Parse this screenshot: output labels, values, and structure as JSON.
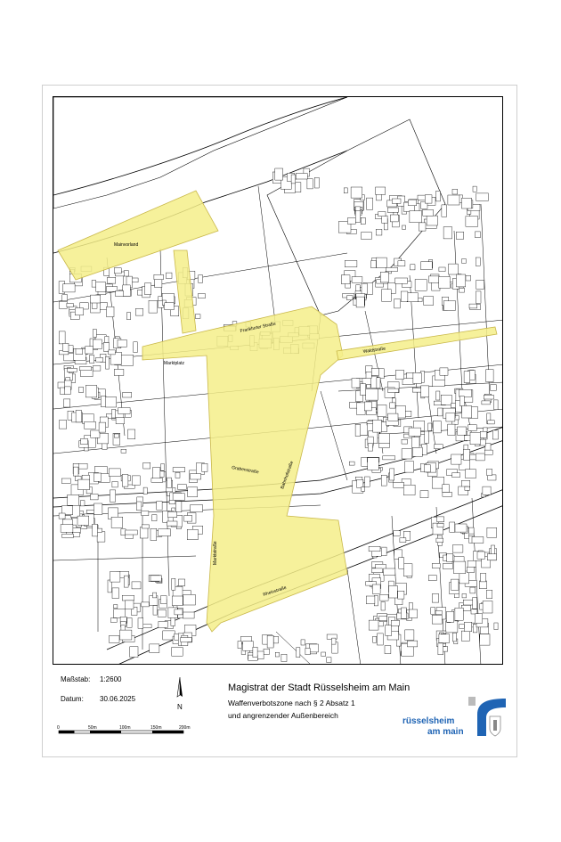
{
  "map": {
    "labels": {
      "mainvorland": "Mainvorland",
      "frankfurter_strasse": "Frankfurter Straße",
      "marktplatz": "Marktplatz",
      "waldstrasse": "Waldstraße",
      "grabenstrasse": "Grabenstraße",
      "bahnhofstrasse": "Bahnhofstraße",
      "marktstrasse": "Marktstraße",
      "rheinstrasse": "Rheinstraße"
    },
    "zone_color": "#f5ef8a",
    "zone_border": "#c9b84a"
  },
  "legend": {
    "scale_label": "Maßstab:",
    "scale_value": "1:2600",
    "date_label": "Datum:",
    "date_value": "30.06.2025"
  },
  "north_arrow": {
    "letter": "N",
    "icon": "north-arrow-icon"
  },
  "scalebar": {
    "ticks": [
      "0",
      "50m",
      "100m",
      "150m",
      "200m"
    ]
  },
  "title": {
    "main": "Magistrat der Stadt Rüsselsheim am Main",
    "line1": "Waffenverbotszone nach § 2 Absatz 1",
    "line2": "und angrenzender Außenbereich"
  },
  "logo": {
    "line1": "rüsselsheim",
    "line2": "am main",
    "color": "#1f64b4",
    "icon": "city-logo-icon"
  }
}
